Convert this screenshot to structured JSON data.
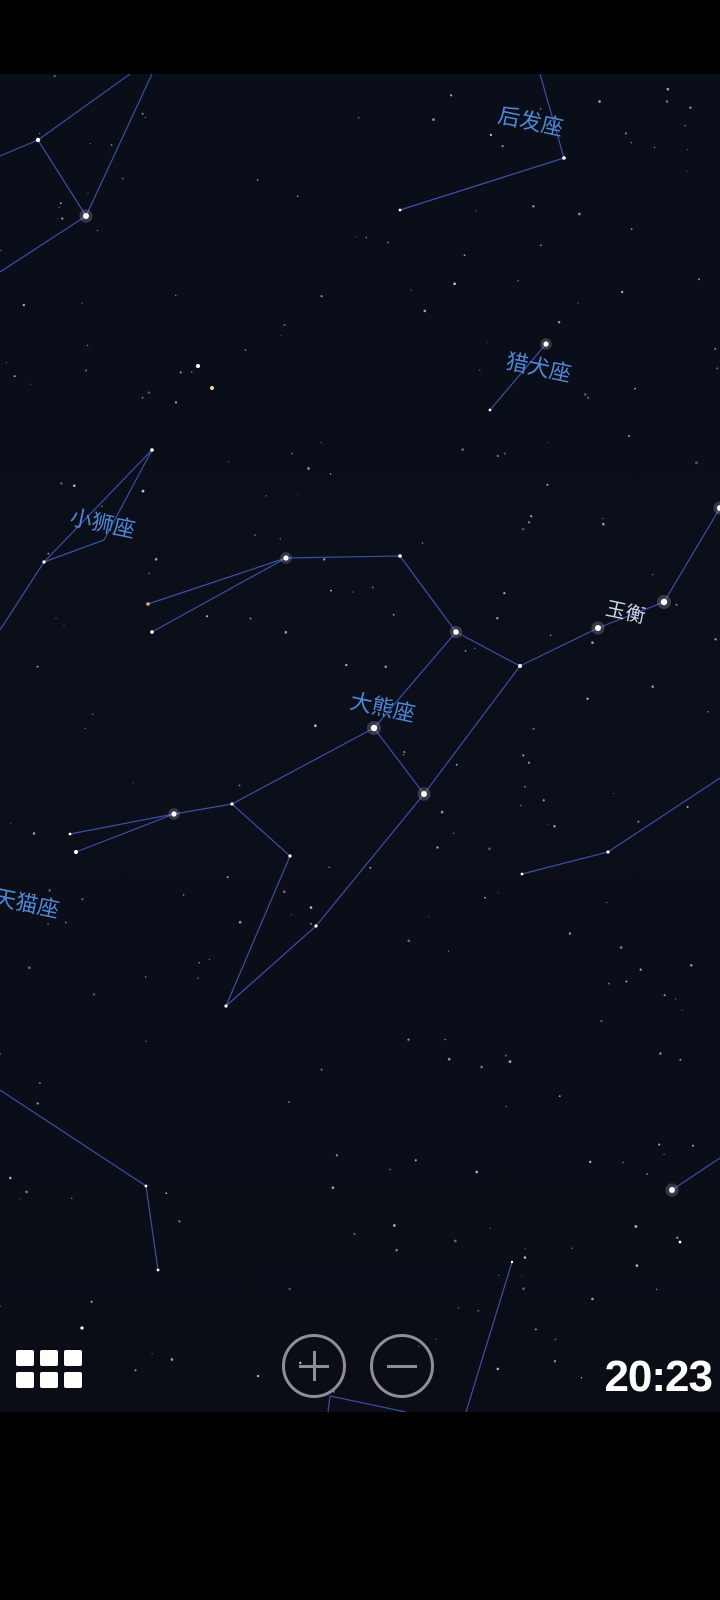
{
  "sky": {
    "constellation_labels": {
      "coma_berenices": "后发座",
      "canes_venatici": "猎犬座",
      "leo_minor": "小狮座",
      "ursa_major": "大熊座",
      "lynx": "天猫座"
    },
    "star_labels": {
      "alioth": "玉衡"
    }
  },
  "controls": {
    "menu_icon": "grid-icon",
    "zoom_in_icon": "plus-icon",
    "zoom_out_icon": "minus-icon"
  },
  "clock": {
    "time": "20:23"
  },
  "colors": {
    "background": "#0a0e18",
    "constellation_line": "#3b4fa8",
    "constellation_label": "#4f86d6"
  }
}
